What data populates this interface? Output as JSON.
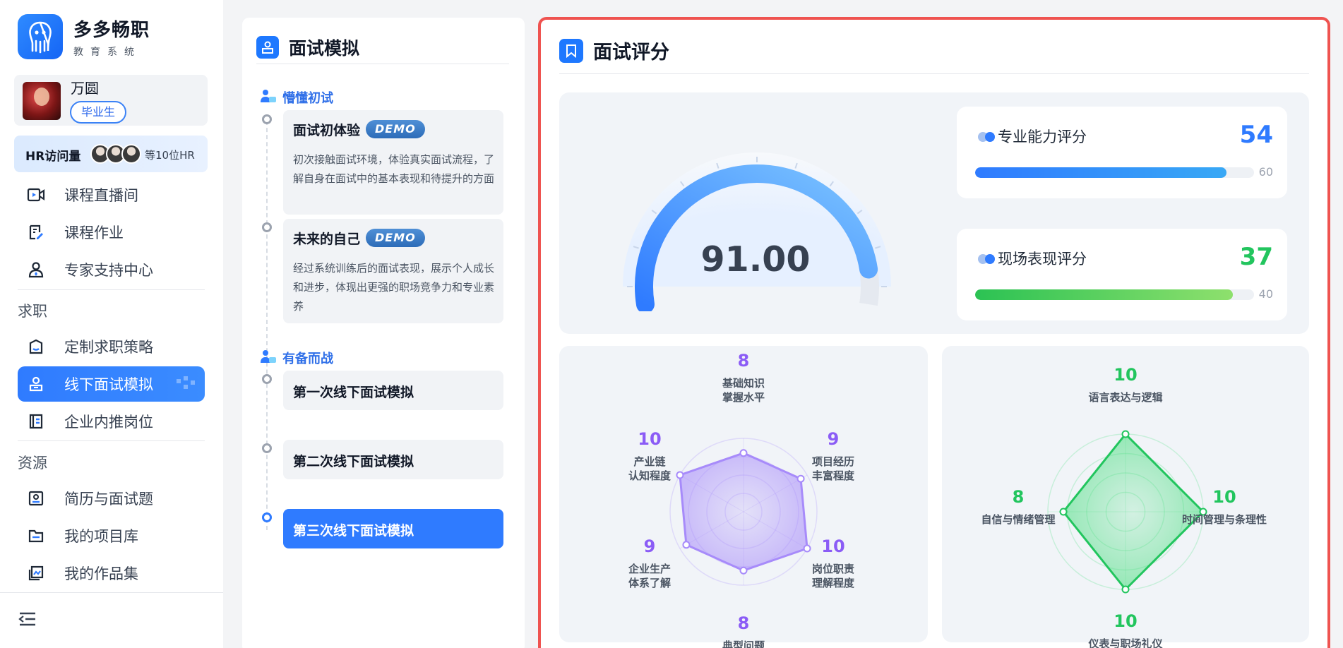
{
  "brand": {
    "name": "多多畅职",
    "subtitle": "教育系统"
  },
  "user": {
    "name": "万圆",
    "badge": "毕业生"
  },
  "hr_visits": {
    "title": "HR访问量",
    "count_text": "等10位HR"
  },
  "nav": {
    "items_top": [
      {
        "label": "课程直播间",
        "icon": "video-icon"
      },
      {
        "label": "课程作业",
        "icon": "homework-icon"
      },
      {
        "label": "专家支持中心",
        "icon": "expert-icon"
      }
    ],
    "section_job": "求职",
    "items_job": [
      {
        "label": "定制求职策略",
        "icon": "strategy-icon"
      },
      {
        "label": "线下面试模拟",
        "icon": "interview-icon",
        "active": true
      },
      {
        "label": "企业内推岗位",
        "icon": "referral-icon"
      }
    ],
    "section_resources": "资源",
    "items_resources": [
      {
        "label": "简历与面试题",
        "icon": "resume-icon"
      },
      {
        "label": "我的项目库",
        "icon": "folder-icon"
      },
      {
        "label": "我的作品集",
        "icon": "portfolio-icon"
      }
    ]
  },
  "mock": {
    "title": "面试模拟",
    "stage1": "懵懂初试",
    "card1_title": "面试初体验",
    "card1_badge": "DEMO",
    "card1_desc": "初次接触面试环境，体验真实面试流程，了解自身在面试中的基本表现和待提升的方面",
    "card2_title": "未来的自己",
    "card2_badge": "DEMO",
    "card2_desc": "经过系统训练后的面试表现，展示个人成长和进步，体现出更强的职场竞争力和专业素养",
    "stage2": "有备而战",
    "item1": "第一次线下面试模拟",
    "item2": "第二次线下面试模拟",
    "item3": "第三次线下面试模拟"
  },
  "score": {
    "title": "面试评分",
    "total": "91.00",
    "total_value": 91,
    "total_max": 100,
    "professional": {
      "label": "专业能力评分",
      "score": "54",
      "max": "60",
      "value": 54,
      "max_value": 60,
      "color": "#2f7bff"
    },
    "onsite": {
      "label": "现场表现评分",
      "score": "37",
      "max": "40",
      "value": 37,
      "max_value": 40,
      "color": "#22c55e"
    }
  },
  "radar_professional": {
    "color": "#8b5cf6",
    "axes": [
      {
        "score": "8",
        "line1": "基础知识",
        "line2": "掌握水平",
        "value": 8
      },
      {
        "score": "9",
        "line1": "项目经历",
        "line2": "丰富程度",
        "value": 9
      },
      {
        "score": "10",
        "line1": "岗位职责",
        "line2": "理解程度",
        "value": 10
      },
      {
        "score": "8",
        "line1": "典型问题",
        "line2": "",
        "value": 8
      },
      {
        "score": "9",
        "line1": "企业生产",
        "line2": "体系了解",
        "value": 9
      },
      {
        "score": "10",
        "line1": "产业链",
        "line2": "认知程度",
        "value": 10
      }
    ],
    "max": 10
  },
  "radar_onsite": {
    "color": "#22c55e",
    "axes": [
      {
        "score": "10",
        "line1": "语言表达与逻辑",
        "value": 10
      },
      {
        "score": "10",
        "line1": "时间管理与条理性",
        "value": 10
      },
      {
        "score": "10",
        "line1": "仪表与职场礼仪",
        "value": 10
      },
      {
        "score": "8",
        "line1": "自信与情绪管理",
        "value": 8
      }
    ],
    "max": 10
  }
}
